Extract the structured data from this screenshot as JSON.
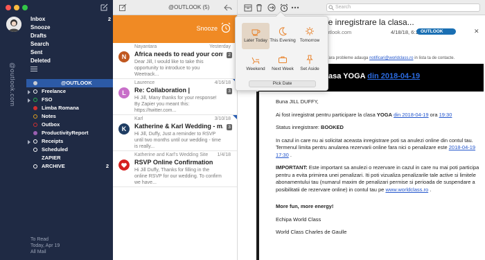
{
  "sidebar": {
    "menu": [
      {
        "label": "Inbox",
        "count": "2"
      },
      {
        "label": "Snooze",
        "count": ""
      },
      {
        "label": "Drafts",
        "count": ""
      },
      {
        "label": "Search",
        "count": ""
      },
      {
        "label": "Sent",
        "count": ""
      },
      {
        "label": "Deleted",
        "count": ""
      }
    ],
    "vertical_label": "@outlook.com",
    "account": "@OUTLOOK",
    "folders": [
      {
        "label": "Freelance",
        "color": "#ffffff",
        "count": "",
        "expand": true
      },
      {
        "label": "FSO",
        "color": "#27b04b",
        "count": "",
        "expand": true
      },
      {
        "label": "Limba Romana",
        "color": "#d03030",
        "count": "",
        "expand": false
      },
      {
        "label": "Notes",
        "color": "#e0a020",
        "count": "",
        "expand": false
      },
      {
        "label": "Outbox",
        "color": "#d03030",
        "count": "",
        "expand": false
      },
      {
        "label": "ProductivityReport",
        "color": "#9a5fb0",
        "count": "",
        "expand": false
      },
      {
        "label": "Receipts",
        "color": "#ffffff",
        "count": "",
        "expand": true
      },
      {
        "label": "Scheduled",
        "color": "#ffffff",
        "count": "",
        "expand": false
      },
      {
        "label": "ZAPIER",
        "color": "#ffffff",
        "count": "",
        "expand": false
      },
      {
        "label": "ARCHIVE",
        "color": "#ffffff",
        "count": "2",
        "expand": false
      }
    ],
    "footer": [
      "To Read",
      "Today, Apr 19",
      "All Mail"
    ]
  },
  "list": {
    "account_name": "@OUTLOOK (5)",
    "snooze_label": "Snooze",
    "messages": [
      {
        "initial": "N",
        "color": "#c0571f",
        "from": "Nayantara",
        "date": "Yesterday",
        "subject": "Africa needs to read your cont...",
        "preview": "Dear Jill, I would like to take this opportunity to introduce to you Weetrack...",
        "badge": "2"
      },
      {
        "initial": "L",
        "color": "#c86fc9",
        "from": "Laurence",
        "date": "4/16/18",
        "subject": "Re: Collaboration |",
        "preview": "Hi Jill, Many thanks for your response! By Zapier you meant this: https://twitter.com...",
        "badge": "3"
      },
      {
        "initial": "K",
        "color": "#1f3d63",
        "from": "Karl",
        "date": "3/10/18",
        "subject": "Katherine & Karl Wedding - m...",
        "preview": "Hi Jill, Duffy, Just a reminder to RSVP until two months until our wedding - time is really...",
        "badge": "3"
      },
      {
        "initial": "",
        "color": "#d62020",
        "from": "Katherine and Karl's Wedding Site",
        "date": "1/4/18",
        "subject": "RSVP Online Confirmation",
        "preview": "Hi Jill Duffy, Thanks for filling in the online RSVP for our wedding. To confirm we have...",
        "badge": ""
      }
    ]
  },
  "reader": {
    "search_placeholder": "Search",
    "subject": "...are inregistrare la clasa...",
    "sender": "...@outlook.com",
    "date": "4/18/18, 6:10 PM",
    "account_badge": "OUTLOOK",
    "notice_prefix": "...nu ai fara probleme adauga",
    "notice_link": "notificari@worldclass.ro",
    "notice_suffix": "in lista ta de contacte.",
    "banner_text": "...gistrare la clasa YOGA",
    "banner_link": "din 2018-04-19",
    "body": {
      "greeting": "Buna JILL DUFFY,",
      "line1_a": "Ai fost inregistrat pentru participare la clasa",
      "line1_class": "YOGA",
      "line1_link": "din 2018-04-19",
      "line1_b": "ora",
      "line1_time": "19:30",
      "status_label": "Status inregistrare:",
      "status_value": "BOOKED",
      "cancel_text": "In cazul in care nu ai solicitat aceasta inregistrare poti sa anulezi online din contul tau.",
      "deadline_text": "Termenul limita pentru anularea rezervarii online fara nici o penalizare este",
      "deadline_link": "2018-04-19 17:30",
      "important_label": "IMPORTANT:",
      "important_text": "Este important sa anulezi o rezervare in cazul in care nu mai poti participa pentru a evita primirea unei penalizari. Iti poti vizualiza penalizarile tale active si limitele abonamentului tau (numarul maxim de penalizari permise si perioada de suspendare a posibilitatii de rezervare online) in contul tau pe",
      "site_link": "www.worldclass.ro",
      "energy": "More fun, more energy!",
      "team": "Echipa World Class",
      "location": "World Class Charles de Gaulle"
    }
  },
  "snooze_popover": {
    "options": [
      {
        "label": "Later Today",
        "icon": "coffee-cup-icon",
        "selected": true
      },
      {
        "label": "This Evening",
        "icon": "moon-icon",
        "selected": false
      },
      {
        "label": "Tomorrow",
        "icon": "sun-icon",
        "selected": false
      },
      {
        "label": "Weekend",
        "icon": "lounge-chair-icon",
        "selected": false
      },
      {
        "label": "Next Week",
        "icon": "briefcase-icon",
        "selected": false
      },
      {
        "label": "Set Aside",
        "icon": "pushpin-icon",
        "selected": false
      }
    ],
    "pick_date": "Pick Date"
  },
  "colors": {
    "sidebar_bg": "#1f2a44",
    "accent_orange": "#f08a24",
    "account_blue": "#2c5aa6"
  }
}
